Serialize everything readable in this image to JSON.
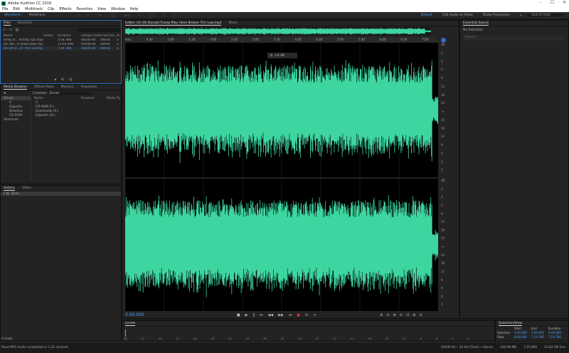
{
  "window": {
    "title": "Adobe Audition CC 2018",
    "controls": [
      "–",
      "☐",
      "✕"
    ]
  },
  "menu": [
    "File",
    "Edit",
    "Multitrack",
    "Clip",
    "Effects",
    "Favorites",
    "View",
    "Window",
    "Help"
  ],
  "toolbar": {
    "waveform": "Waveform",
    "multitrack": "Multitrack",
    "workspaces": [
      "Default",
      "Edit Audio to Video",
      "Radio Production"
    ],
    "search_placeholder": "Search Help"
  },
  "files": {
    "tabs": [
      "Files",
      "Favorites"
    ],
    "columns": [
      "Name",
      "Status",
      "Duration",
      "Sample Rate",
      "Channels",
      "Bi"
    ],
    "rows": [
      {
        "name": "Emily B... Acting Tips.mp3",
        "duration": "3:54.368",
        "rate": "44100 Hz",
        "channels": "Stereo",
        "bits": "3",
        "selected": false
      },
      {
        "name": "Jon Ste...e Show Desk.mp3",
        "duration": "13:50.498",
        "rate": "44100 Hz",
        "channels": "Stereo",
        "bits": "3",
        "selected": false
      },
      {
        "name": "Uh-Oh D...en The Law.mp3",
        "duration": "7:24.786",
        "rate": "44100 Hz",
        "channels": "Stereo",
        "bits": "3",
        "selected": true
      }
    ]
  },
  "media": {
    "tabs": [
      "Media Browser",
      "Effects Rack",
      "Markers",
      "Properties"
    ],
    "contents_label": "Contents:",
    "contents_value": "Drives",
    "tree": [
      "Drives",
      "C:",
      "Gigantin",
      "Downloa",
      "CD-ROM",
      "Shortcuts"
    ],
    "columns": [
      "Name",
      "Duration",
      "Media Ty"
    ],
    "items": [
      "C:",
      "CD-ROM (F:)",
      "Downloads (E:)",
      "Gigantin (D:)"
    ]
  },
  "history": {
    "tabs": [
      "History",
      "Video"
    ],
    "items": [
      "Open"
    ],
    "undo": "0 Undo"
  },
  "editor": {
    "tabs": [
      "Editor: Uh-Oh Donald Trump May Have Broken The Law.mp3",
      "Mixer"
    ],
    "ruler": [
      "hms",
      "0:30",
      "1:00",
      "1:30",
      "2:00",
      "2:30",
      "3:00",
      "3:30",
      "4:00",
      "4:30",
      "5:00",
      "5:30",
      "6:00",
      "6:30",
      "7:00"
    ],
    "db_scale": [
      "dB",
      "1",
      "3",
      "6",
      "9",
      "12",
      "18",
      "24",
      "-∞",
      "24",
      "18",
      "12",
      "9",
      "6",
      "3",
      "1"
    ],
    "hud_gain": "+0 dB",
    "current_time": "0:00.000",
    "waveform_color": "#3ed6a0"
  },
  "levels": {
    "title": "Levels",
    "scale": [
      "dB",
      "-57",
      "-54",
      "-51",
      "-48",
      "-45",
      "-42",
      "-39",
      "-36",
      "-33",
      "-30",
      "-27",
      "-24",
      "-21",
      "-18",
      "-15",
      "-12",
      "-9",
      "-6",
      "-3",
      "0"
    ]
  },
  "essential": {
    "title": "Essential Sound",
    "status": "No Selection",
    "preset_placeholder": "Preset:"
  },
  "selection_view": {
    "title": "Selection/View",
    "cols": [
      "Start",
      "End",
      "Duration"
    ],
    "rows": [
      {
        "label": "Selection",
        "values": [
          "0:00.000",
          "0:00.000",
          "0:00.000"
        ]
      },
      {
        "label": "View",
        "values": [
          "0:00.000",
          "7:24.786",
          "7:24.786"
        ]
      }
    ]
  },
  "status": {
    "message": "Read MP3 Audio completed in 1.22 seconds",
    "format": "44100 Hz • 32-bit (Float) • Stereo",
    "size": "149.99 MB",
    "duration": "7:25.805",
    "free": "53.83 GB free"
  }
}
